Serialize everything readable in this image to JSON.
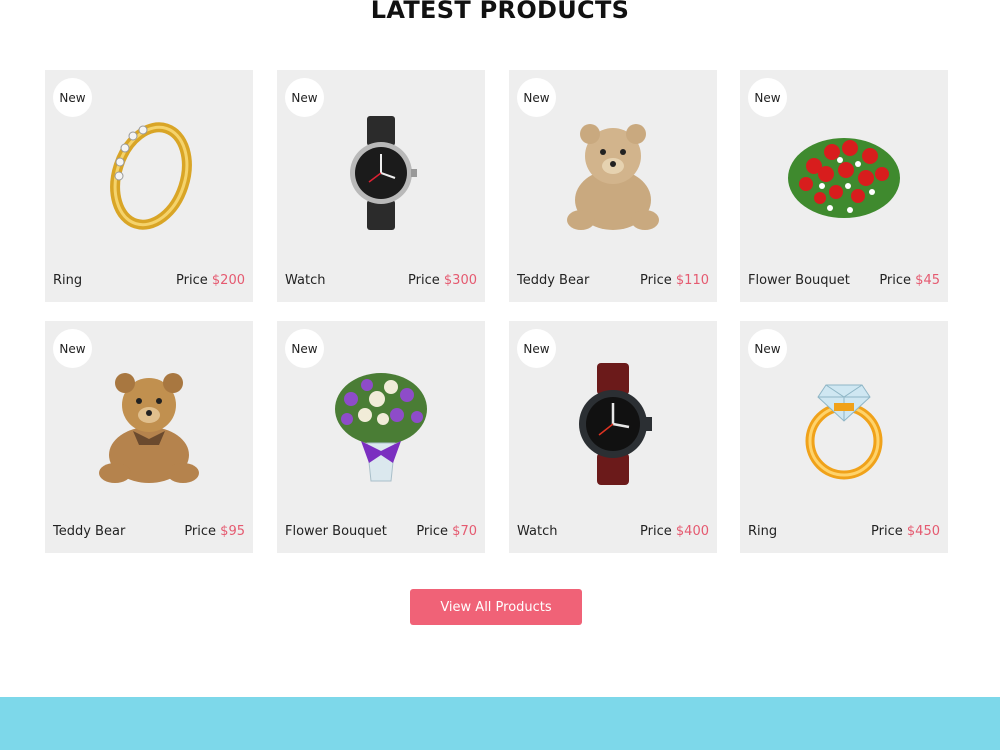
{
  "section": {
    "title": "LATEST PRODUCTS"
  },
  "products": [
    {
      "badge": "New",
      "name": "Ring",
      "price_label": "Price",
      "price": "$200",
      "icon": "gold-ring-icon"
    },
    {
      "badge": "New",
      "name": "Watch",
      "price_label": "Price",
      "price": "$300",
      "icon": "watch-icon"
    },
    {
      "badge": "New",
      "name": "Teddy Bear",
      "price_label": "Price",
      "price": "$110",
      "icon": "teddy-bear-icon"
    },
    {
      "badge": "New",
      "name": "Flower Bouquet",
      "price_label": "Price",
      "price": "$45",
      "icon": "rose-bouquet-icon"
    },
    {
      "badge": "New",
      "name": "Teddy Bear",
      "price_label": "Price",
      "price": "$95",
      "icon": "teddy-bear-icon"
    },
    {
      "badge": "New",
      "name": "Flower Bouquet",
      "price_label": "Price",
      "price": "$70",
      "icon": "flower-vase-icon"
    },
    {
      "badge": "New",
      "name": "Watch",
      "price_label": "Price",
      "price": "$400",
      "icon": "sport-watch-icon"
    },
    {
      "badge": "New",
      "name": "Ring",
      "price_label": "Price",
      "price": "$450",
      "icon": "diamond-ring-icon"
    }
  ],
  "actions": {
    "view_all_label": "View All Products"
  },
  "colors": {
    "card_bg": "#eeeeee",
    "price_accent": "#e55a70",
    "button_bg": "#f06277",
    "footer_band": "#7dd8ea"
  }
}
